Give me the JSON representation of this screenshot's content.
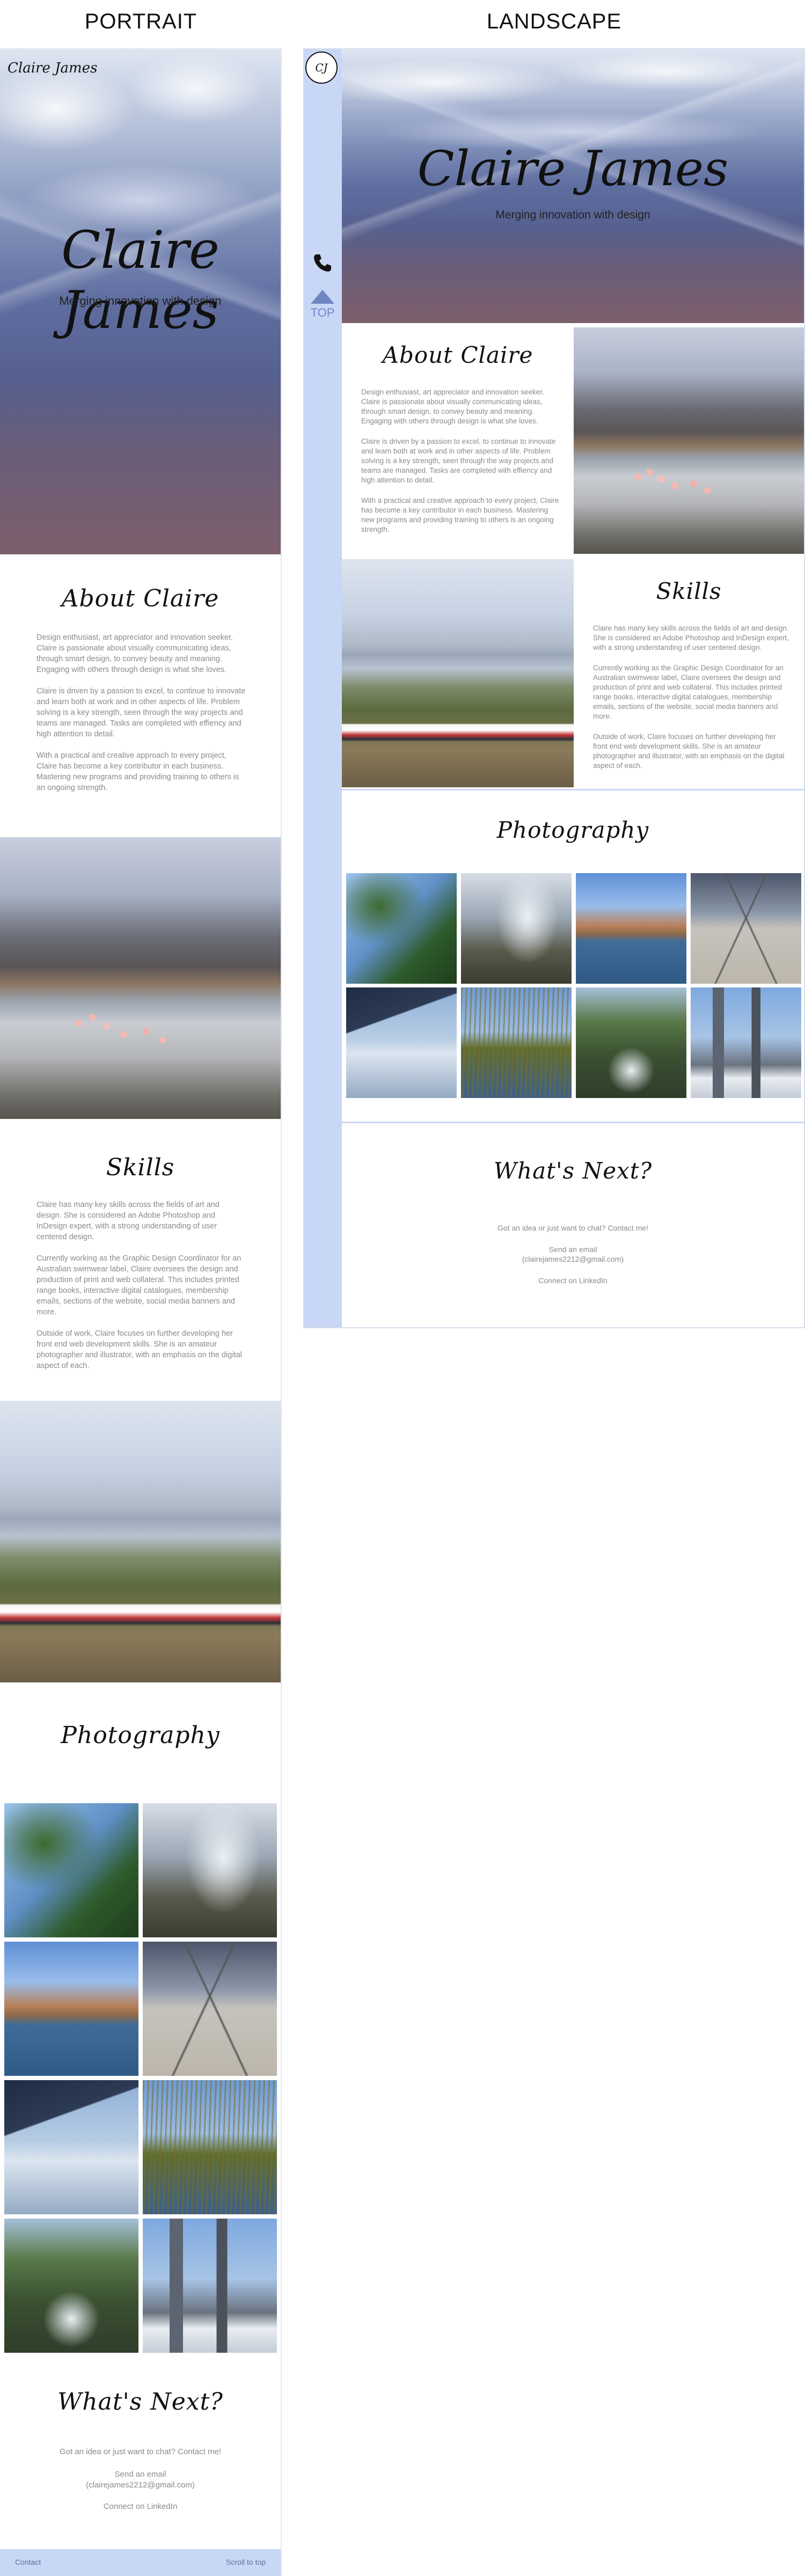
{
  "columns": {
    "portrait_label": "PORTRAIT",
    "landscape_label": "LANDSCAPE"
  },
  "brand": {
    "logo_text": "Claire James",
    "logo_mono": "CJ",
    "name": "Claire James",
    "tagline": "Merging innovation with design"
  },
  "about": {
    "heading": "About Claire",
    "p1": "Design enthusiast, art appreciator and innovation seeker. Claire is passionate about visually communicating ideas, through smart design, to convey beauty and meaning. Engaging with others through design is what she loves.",
    "p2": "Claire is driven by a passion to excel, to continue to innovate and learn both at work and in other aspects of life. Problem solving is a key strength, seen through the way projects and teams are managed. Tasks are completed with effiency and high attention to detail.",
    "p3": "With a practical and creative approach to every project, Claire has become a key contributor in each business. Mastering new programs and providing training to others is an ongoing strength."
  },
  "skills": {
    "heading": "Skills",
    "p1": "Claire has many key skills across the fields of art and design. She is considered an Adobe Photoshop and InDesign expert, with a strong understanding of user centered design.",
    "p2": "Currently working as the Graphic Design Coordinator for an Australian swimwear label, Claire oversees the design and production of print and web collateral. This includes printed range books, interactive digital catalogues, membership emails, sections of the website, social media banners and more.",
    "p3": "Outside of work, Claire focuses on further developing her front end web development skills. She is an amateur photographer and illustrator, with an emphasis on the digital aspect of each."
  },
  "photography": {
    "heading": "Photography",
    "photos": [
      "palm",
      "falls",
      "lake",
      "tracks",
      "wing",
      "reeds",
      "stream",
      "city"
    ]
  },
  "next": {
    "heading": "What's Next?",
    "intro": "Got an idea or just want to chat? Contact me!",
    "email_label": "Send an email",
    "email": "(clairejames2212@gmail.com)",
    "linkedin": "Connect on LinkedIn"
  },
  "footer": {
    "contact": "Contact",
    "scroll_top": "Scroll to top"
  },
  "rail": {
    "phone_icon": "phone-icon",
    "top_label": "TOP"
  },
  "colors": {
    "accent_blue": "#c9d7f6",
    "top_arrow": "#6f86c2",
    "footer_bar": "#c9d7f6"
  }
}
